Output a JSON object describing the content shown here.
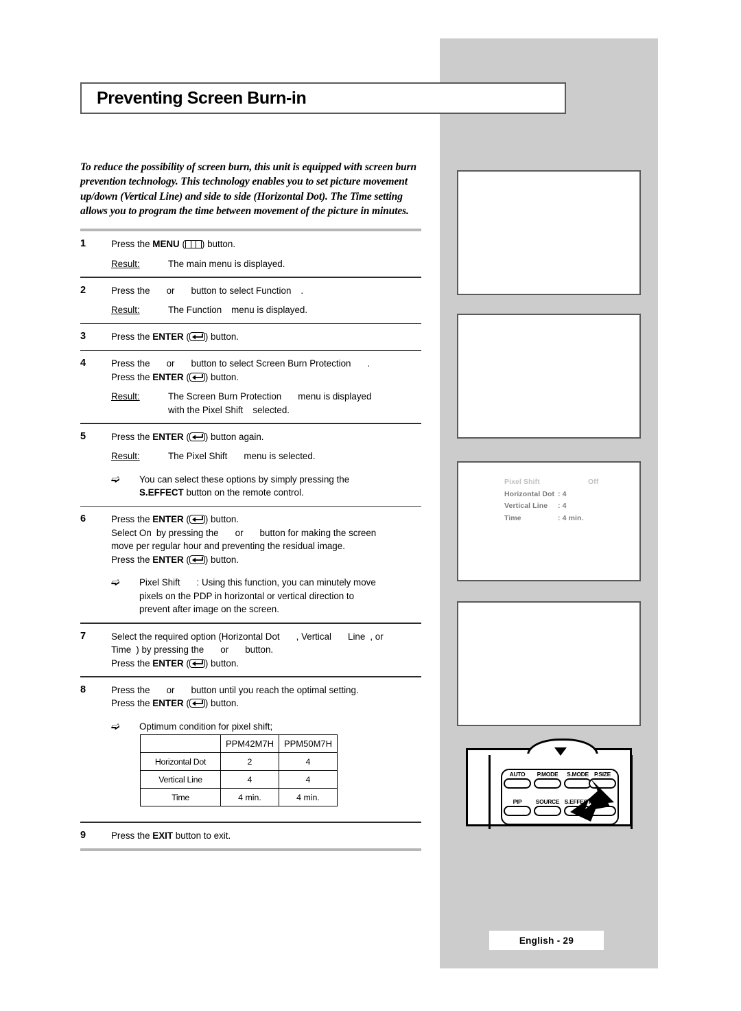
{
  "page": {
    "title": "Preventing Screen Burn-in",
    "footer": "English - 29",
    "intro": "To reduce the possibility of screen burn, this unit is equipped with screen burn prevention technology. This technology enables you to set picture movement up/down (Vertical Line) and side to side (Horizontal Dot). The Time setting allows you to program the time between movement of the picture in minutes."
  },
  "steps": [
    {
      "num": "1",
      "lines": [
        "Press the MENU ( ) button."
      ],
      "l1a": "Press the ",
      "l1b": "MENU",
      "l1c": " (",
      "l1d": ") button.",
      "result_label": "Result:",
      "result_text": "The main menu is displayed."
    },
    {
      "num": "2",
      "l1a": "Press the",
      "l1b": "or",
      "l1c": "button to select Function",
      "l1d": ".",
      "result_label": "Result:",
      "r1": "The Function",
      "r2": "menu is displayed."
    },
    {
      "num": "3",
      "l1a": "Press the ",
      "l1b": "ENTER",
      "l1c": " (",
      "l1d": ") button."
    },
    {
      "num": "4",
      "l1a": "Press the",
      "l1b": "or",
      "l1c": "button to select Screen Burn Protection",
      "l1d": ".",
      "l2a": "Press the ",
      "l2b": "ENTER",
      "l2c": " (",
      "l2d": ") button.",
      "result_label": "Result:",
      "r1": "The Screen Burn Protection",
      "r2": "menu is displayed",
      "r3": "with the Pixel Shift",
      "r4": "selected."
    },
    {
      "num": "5",
      "l1a": "Press the ",
      "l1b": "ENTER",
      "l1c": " (",
      "l1d": ") button again.",
      "result_label": "Result:",
      "r1": "The Pixel Shift",
      "r2": "menu is selected.",
      "note1": "You can select these options by simply pressing the",
      "note1b": "S.EFFECT",
      "note1c": " button on the remote control."
    },
    {
      "num": "6",
      "l1a": "Press the ",
      "l1b": "ENTER",
      "l1c": " (",
      "l1d": ") button.",
      "l2a": "Select On",
      "l2b": "by pressing the",
      "l2c": "or",
      "l2d": "button for making the screen",
      "l3": "move per regular hour and preventing the residual image.",
      "l4a": "Press the ",
      "l4b": "ENTER",
      "l4c": " (",
      "l4d": ") button.",
      "note1a": "Pixel Shift",
      "note1b": ": Using this function, you can minutely move",
      "note2": "pixels on the PDP in horizontal or vertical direction to",
      "note3": "prevent after image on the screen."
    },
    {
      "num": "7",
      "l1a": "Select the required option (Horizontal Dot",
      "l1b": ", Vertical",
      "l1c": "Line",
      "l1d": ", or",
      "l2a": "Time",
      "l2b": ") by pressing the",
      "l2c": "or",
      "l2d": "button.",
      "l3a": "Press the ",
      "l3b": "ENTER",
      "l3c": " (",
      "l3d": ") button."
    },
    {
      "num": "8",
      "l1a": "Press the",
      "l1b": "or",
      "l1c": "button until you reach the optimal setting.",
      "l2a": "Press the ",
      "l2b": "ENTER",
      "l2c": " (",
      "l2d": ") button.",
      "note1": "Optimum condition for pixel shift;"
    },
    {
      "num": "9",
      "l1a": "Press the ",
      "l1b": "EXIT",
      "l1c": " button to exit."
    }
  ],
  "spec_table": {
    "corner": "",
    "columns": [
      "PPM42M7H",
      "PPM50M7H"
    ],
    "rows": [
      {
        "label": "Horizontal Dot",
        "values": [
          "2",
          "4"
        ]
      },
      {
        "label": "Vertical Line",
        "values": [
          "4",
          "4"
        ]
      },
      {
        "label": "Time",
        "values": [
          "4 min.",
          "4 min."
        ]
      }
    ]
  },
  "osd": {
    "rows": [
      {
        "label": "Pixel Shift",
        "value": "Off",
        "dim": true
      },
      {
        "label": "Horizontal Dot",
        "value": ": 4",
        "dim": false
      },
      {
        "label": "Vertical Line",
        "value": ": 4",
        "dim": false
      },
      {
        "label": "Time",
        "value": ": 4 min.",
        "dim": false
      }
    ]
  },
  "remote": {
    "buttons_row1": [
      "AUTO",
      "P.MODE",
      "S.MODE",
      "P.SIZE"
    ],
    "buttons_row2": [
      "PIP",
      "SOURCE",
      "S.EFFECT"
    ]
  },
  "colors": {
    "panel_gray": "#cccccc",
    "box_border": "#595959",
    "rule_thick": "#b6b6b6",
    "rule_thin": "#2b2b2b",
    "osd_dim": "#c0c0c0",
    "osd_text": "#7a7a7a"
  }
}
